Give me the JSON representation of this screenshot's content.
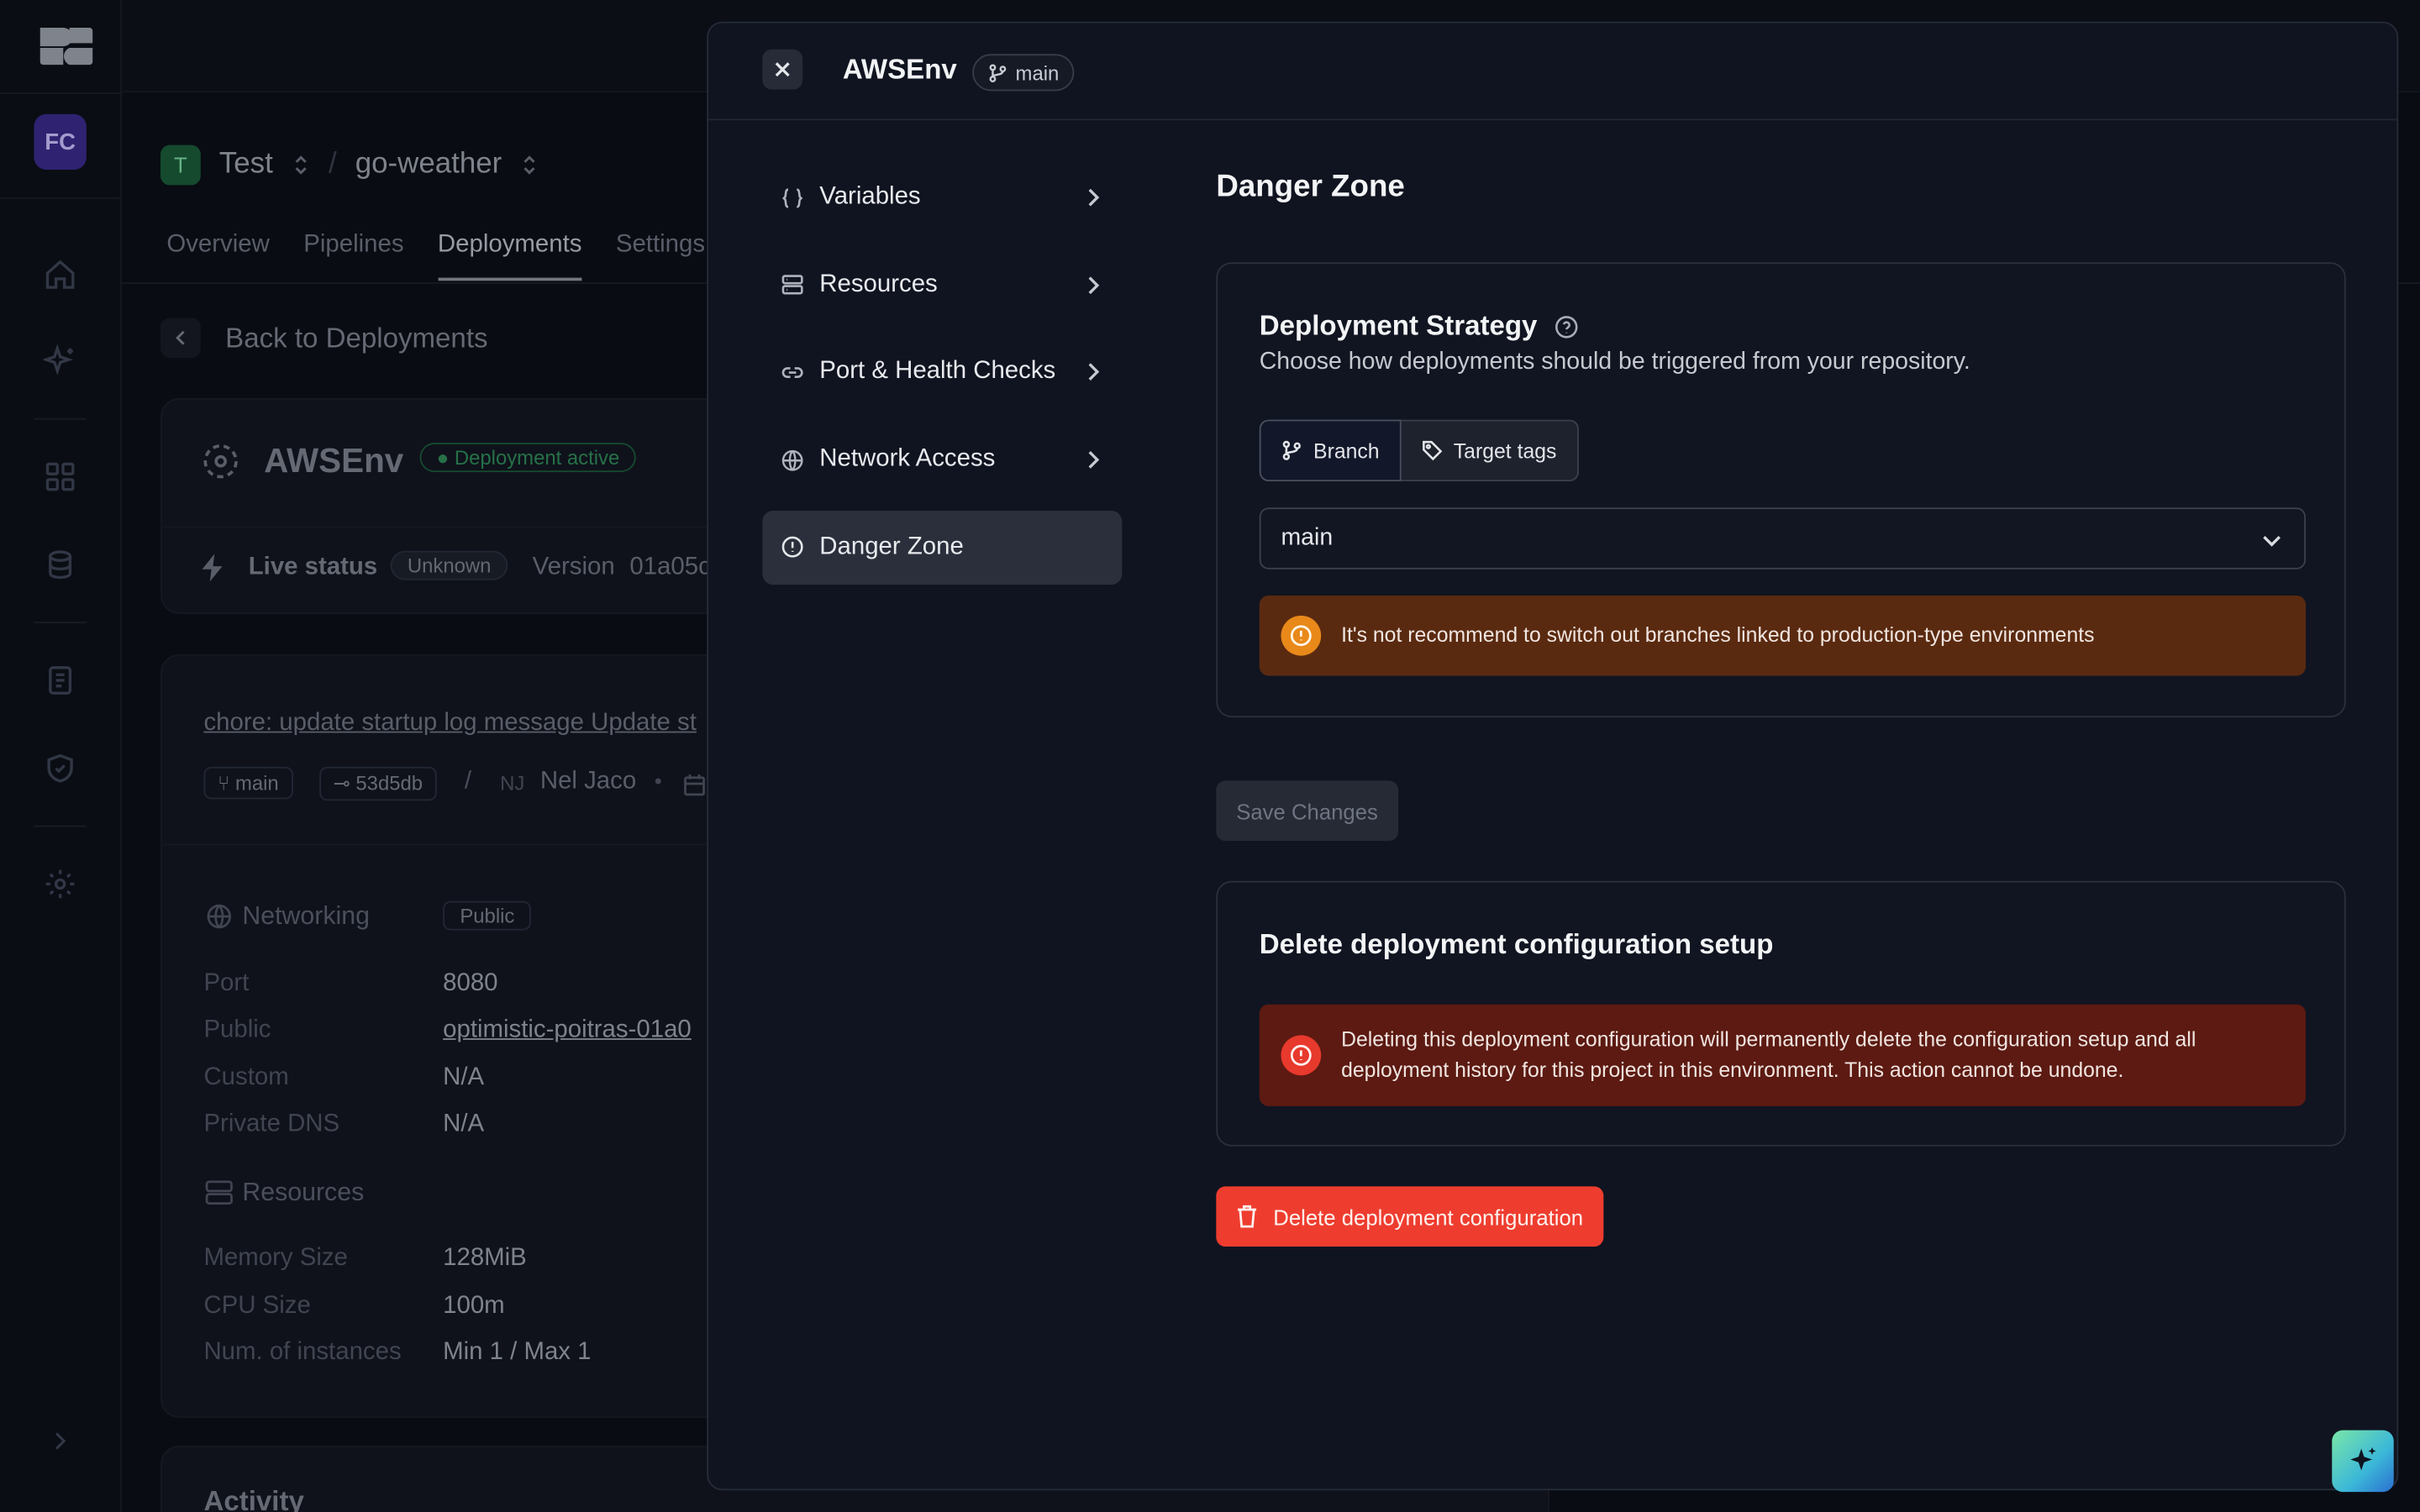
{
  "sidebar": {
    "avatar_initials": "FC",
    "icons": [
      "home-icon",
      "sparkles-icon",
      "grid-icon",
      "database-icon",
      "document-icon",
      "shield-check-icon",
      "gear-icon",
      "chevron-right-icon"
    ]
  },
  "breadcrumb": {
    "project_initial": "T",
    "project": "Test",
    "separator": "/",
    "service": "go-weather"
  },
  "tabs": [
    "Overview",
    "Pipelines",
    "Deployments",
    "Settings"
  ],
  "back_label": "Back to Deployments",
  "environment_card": {
    "name": "AWSEnv",
    "status": "Deployment active",
    "live_status_label": "Live status",
    "live_status_value": "Unknown",
    "version_label": "Version",
    "version_value": "01a05c"
  },
  "commit_card": {
    "message": "chore: update startup log message Update st",
    "branch": "main",
    "sha": "53d5db",
    "separator": "/",
    "author_initials": "NJ",
    "author": "Nel Jaco",
    "dot": "•"
  },
  "details": {
    "networking_label": "Networking",
    "networking_badge": "Public",
    "rows": [
      {
        "k": "Port",
        "v": "8080"
      },
      {
        "k": "Public",
        "v": "optimistic-poitras-01a0"
      },
      {
        "k": "Custom",
        "v": "N/A"
      },
      {
        "k": "Private DNS",
        "v": "N/A"
      }
    ],
    "resources_label": "Resources",
    "resource_rows": [
      {
        "k": "Memory Size",
        "v": "128MiB"
      },
      {
        "k": "CPU Size",
        "v": "100m"
      },
      {
        "k": "Num. of instances",
        "v": "Min 1 / Max 1"
      }
    ],
    "activity_label": "Activity"
  },
  "modal": {
    "title": "AWSEnv",
    "branch": "main",
    "nav": [
      {
        "label": "Variables",
        "icon": "braces-icon"
      },
      {
        "label": "Resources",
        "icon": "server-icon"
      },
      {
        "label": "Port & Health Checks",
        "icon": "link-icon"
      },
      {
        "label": "Network Access",
        "icon": "globe-icon"
      },
      {
        "label": "Danger Zone",
        "icon": "alert-circle-icon"
      }
    ],
    "selected": "Danger Zone",
    "heading": "Danger Zone",
    "strategy": {
      "title": "Deployment Strategy",
      "description": "Choose how deployments should be triggered from your repository.",
      "options": [
        "Branch",
        "Target tags"
      ],
      "selected_option": "Branch",
      "branch_value": "main",
      "warning": "It's not recommend to switch out branches linked to production-type environments"
    },
    "save_label": "Save Changes",
    "delete_section": {
      "title": "Delete deployment configuration setup",
      "message": "Deleting this deployment configuration will permanently delete the configuration setup and all deployment history for this project in this environment. This action cannot be undone.",
      "button": "Delete deployment configuration"
    }
  },
  "colors": {
    "danger": "#ee3d2f",
    "warning_bg": "#5a2a10",
    "error_bg": "#5c1a12",
    "warning_icon": "#e8891a"
  }
}
